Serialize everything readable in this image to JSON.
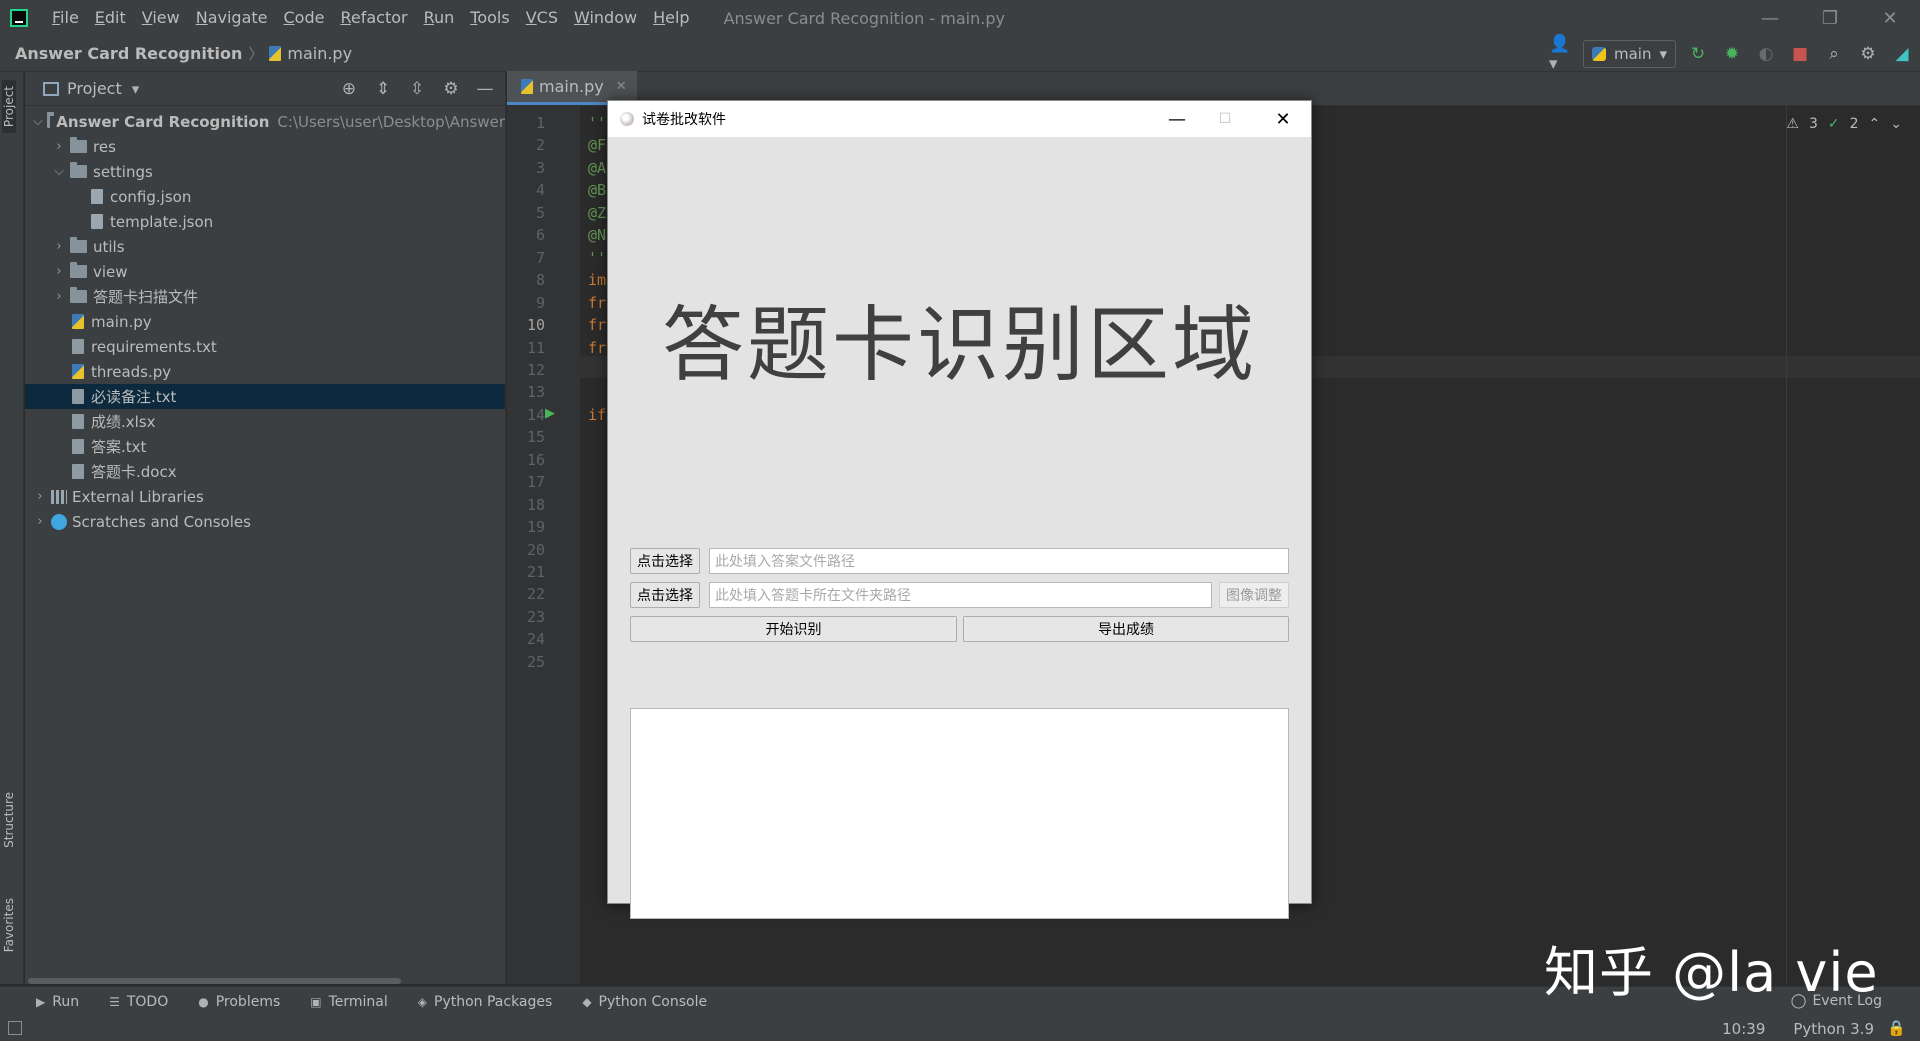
{
  "menu": {
    "items": [
      {
        "label": "File",
        "mnemonic": "F",
        "rest": "ile"
      },
      {
        "label": "Edit",
        "mnemonic": "E",
        "rest": "dit"
      },
      {
        "label": "View",
        "mnemonic": "V",
        "rest": "iew"
      },
      {
        "label": "Navigate",
        "mnemonic": "N",
        "rest": "avigate"
      },
      {
        "label": "Code",
        "mnemonic": "C",
        "rest": "ode"
      },
      {
        "label": "Refactor",
        "mnemonic": "R",
        "rest": "efactor"
      },
      {
        "label": "Run",
        "mnemonic": "R",
        "rest": "un"
      },
      {
        "label": "Tools",
        "mnemonic": "T",
        "rest": "ools"
      },
      {
        "label": "VCS",
        "mnemonic": "V",
        "rest": "CS"
      },
      {
        "label": "Window",
        "mnemonic": "W",
        "rest": "indow"
      },
      {
        "label": "Help",
        "mnemonic": "H",
        "rest": "elp"
      }
    ],
    "window_title": "Answer Card Recognition - main.py"
  },
  "navbar": {
    "project": "Answer Card Recognition",
    "file": "main.py",
    "run_config": "main"
  },
  "left_strip": {
    "project": "Project",
    "structure": "Structure",
    "favorites": "Favorites"
  },
  "project_panel": {
    "header": "Project",
    "root_name": "Answer Card Recognition",
    "root_path": "C:\\Users\\user\\Desktop\\Answer",
    "tree": [
      {
        "label": "res",
        "kind": "folder",
        "expand": "collapsed",
        "depth": 1
      },
      {
        "label": "settings",
        "kind": "folder",
        "expand": "expanded",
        "depth": 1
      },
      {
        "label": "config.json",
        "kind": "json",
        "expand": "none",
        "depth": 2
      },
      {
        "label": "template.json",
        "kind": "json",
        "expand": "none",
        "depth": 2
      },
      {
        "label": "utils",
        "kind": "folder",
        "expand": "collapsed",
        "depth": 1
      },
      {
        "label": "view",
        "kind": "folder",
        "expand": "collapsed",
        "depth": 1
      },
      {
        "label": "答题卡扫描文件",
        "kind": "folder",
        "expand": "collapsed",
        "depth": 1
      },
      {
        "label": "main.py",
        "kind": "py",
        "expand": "none",
        "depth": 1
      },
      {
        "label": "requirements.txt",
        "kind": "txt",
        "expand": "none",
        "depth": 1
      },
      {
        "label": "threads.py",
        "kind": "py",
        "expand": "none",
        "depth": 1
      },
      {
        "label": "必读备注.txt",
        "kind": "txt",
        "expand": "none",
        "depth": 1,
        "selected": true
      },
      {
        "label": "成绩.xlsx",
        "kind": "txt",
        "expand": "none",
        "depth": 1
      },
      {
        "label": "答案.txt",
        "kind": "txt",
        "expand": "none",
        "depth": 1
      },
      {
        "label": "答题卡.docx",
        "kind": "txt",
        "expand": "none",
        "depth": 1
      }
    ],
    "external_libraries": "External Libraries",
    "scratches": "Scratches and Consoles"
  },
  "editor": {
    "tab": "main.py",
    "current_line": "10",
    "lines": [
      {
        "n": "1",
        "code": "''",
        "color": "#629755"
      },
      {
        "n": "2",
        "code": "@F",
        "color": "#629755"
      },
      {
        "n": "3",
        "code": "@A",
        "color": "#629755"
      },
      {
        "n": "4",
        "code": "@B",
        "color": "#629755"
      },
      {
        "n": "5",
        "code": "@Z",
        "color": "#629755"
      },
      {
        "n": "6",
        "code": "@N",
        "color": "#629755"
      },
      {
        "n": "7",
        "code": "''",
        "color": "#629755"
      },
      {
        "n": "8",
        "code": "im",
        "color": "#cc7832"
      },
      {
        "n": "9",
        "code": "fr",
        "color": "#cc7832"
      },
      {
        "n": "10",
        "code": "fr",
        "color": "#cc7832"
      },
      {
        "n": "11",
        "code": "fr",
        "color": "#cc7832"
      },
      {
        "n": "12",
        "code": "",
        "color": "#a9b7c6"
      },
      {
        "n": "13",
        "code": "",
        "color": "#a9b7c6"
      },
      {
        "n": "14",
        "code": "if",
        "color": "#cc7832"
      },
      {
        "n": "15",
        "code": "",
        "color": "#a9b7c6"
      },
      {
        "n": "16",
        "code": "",
        "color": "#a9b7c6"
      },
      {
        "n": "17",
        "code": "",
        "color": "#a9b7c6"
      },
      {
        "n": "18",
        "code": "",
        "color": "#a9b7c6"
      },
      {
        "n": "19",
        "code": "",
        "color": "#a9b7c6"
      },
      {
        "n": "20",
        "code": "",
        "color": "#a9b7c6"
      },
      {
        "n": "21",
        "code": "",
        "color": "#a9b7c6"
      },
      {
        "n": "22",
        "code": "",
        "color": "#a9b7c6"
      },
      {
        "n": "23",
        "code": "",
        "color": "#a9b7c6"
      },
      {
        "n": "24",
        "code": "",
        "color": "#a9b7c6"
      },
      {
        "n": "25",
        "code": "",
        "color": "#a9b7c6"
      }
    ],
    "warnings": "3",
    "checks": "2"
  },
  "qt_window": {
    "title": "试卷批改软件",
    "recog_area": "答题卡识别区域",
    "select_answer_btn": "点击选择",
    "answer_placeholder": "此处填入答案文件路径",
    "select_cards_btn": "点击选择",
    "cards_placeholder": "此处填入答题卡所在文件夹路径",
    "adjust_btn": "图像调整",
    "start_btn": "开始识别",
    "export_btn": "导出成绩"
  },
  "bottom": {
    "tabs": [
      {
        "label": "Run",
        "icon": "▶"
      },
      {
        "label": "TODO",
        "icon": "☰"
      },
      {
        "label": "Problems",
        "icon": "●"
      },
      {
        "label": "Terminal",
        "icon": "▣"
      },
      {
        "label": "Python Packages",
        "icon": "◈"
      },
      {
        "label": "Python Console",
        "icon": "◆"
      }
    ],
    "event_log": "Event Log"
  },
  "status": {
    "time": "10:39",
    "interpreter": "Python 3.9"
  },
  "watermark": "知乎 @la vie"
}
